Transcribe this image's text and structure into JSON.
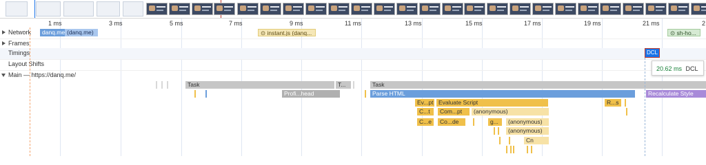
{
  "ruler": {
    "ticks": [
      "1 ms",
      "3 ms",
      "5 ms",
      "7 ms",
      "9 ms",
      "11 ms",
      "13 ms",
      "15 ms",
      "17 ms",
      "19 ms",
      "21 ms",
      "2"
    ]
  },
  "tracks": {
    "network": "Network",
    "frames": "Frames",
    "timings": "Timings",
    "layout_shifts": "Layout Shifts",
    "main": "Main — https://danq.me/"
  },
  "network": {
    "req1": "danq.me",
    "req2": "(danq.me)",
    "req3": "⊙ instant.js (danq...",
    "req4": "⊙ sh-ho..."
  },
  "timings": {
    "dcl_label": "DCL",
    "tooltip_ms": "20.62 ms",
    "tooltip_event": "DCL"
  },
  "flame": {
    "task1": "Task",
    "task2": "T...",
    "task3": "Task",
    "profile": "Profi...head",
    "parse_html": "Parse HTML",
    "recalc_style": "Recalculate Style",
    "ev_pt": "Ev...pt",
    "evaluate_script": "Evaluate Script",
    "rs": "R...s",
    "ct": "C...t",
    "compt": "Com...pt",
    "anon1": "(anonymous)",
    "ce": "C...e",
    "code": "Co...de",
    "g": "g...",
    "anon2": "(anonymous)",
    "anon3": "(anonymous)",
    "cn": "Cn"
  },
  "colors": {
    "network_html": "#6b9edc",
    "task": "#c6c6c6",
    "parse_html": "#6b9edc",
    "scripting": "#f0c04a",
    "rendering": "#a88ad9",
    "dcl": "#1a73e8",
    "tooltip_ms": "#188038"
  }
}
